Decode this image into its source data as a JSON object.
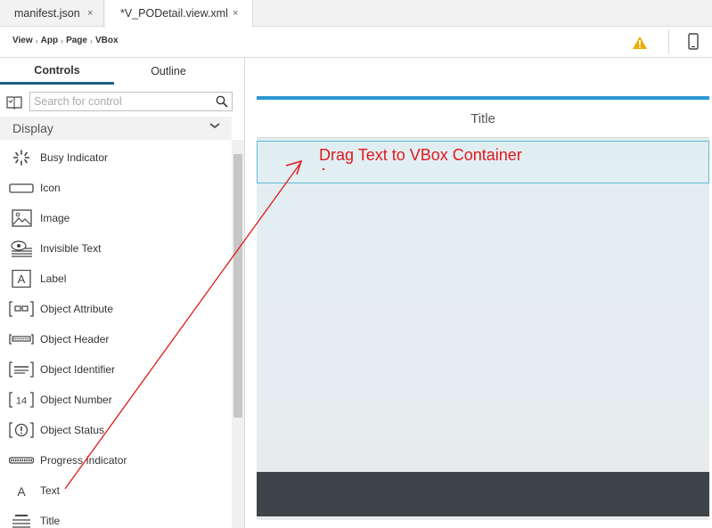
{
  "tabs": [
    {
      "label": "manifest.json",
      "close": "×"
    },
    {
      "label": "*V_PODetail.view.xml",
      "close": "×"
    }
  ],
  "breadcrumb": [
    "View",
    "App",
    "Page",
    "VBox"
  ],
  "panel_tabs": {
    "controls": "Controls",
    "outline": "Outline"
  },
  "search": {
    "placeholder": "Search for control",
    "value": ""
  },
  "category": {
    "label": "Display"
  },
  "controls": [
    {
      "label": "Busy Indicator",
      "icon": "busy-indicator-icon"
    },
    {
      "label": "Icon",
      "icon": "icon-placeholder-icon"
    },
    {
      "label": "Image",
      "icon": "image-icon"
    },
    {
      "label": "Invisible Text",
      "icon": "invisible-text-icon"
    },
    {
      "label": "Label",
      "icon": "label-icon"
    },
    {
      "label": "Object Attribute",
      "icon": "object-attribute-icon"
    },
    {
      "label": "Object Header",
      "icon": "object-header-icon"
    },
    {
      "label": "Object Identifier",
      "icon": "object-identifier-icon"
    },
    {
      "label": "Object Number",
      "icon": "object-number-icon"
    },
    {
      "label": "Object Status",
      "icon": "object-status-icon"
    },
    {
      "label": "Progress Indicator",
      "icon": "progress-indicator-icon"
    },
    {
      "label": "Text",
      "icon": "text-icon"
    },
    {
      "label": "Title",
      "icon": "title-icon"
    }
  ],
  "canvas": {
    "page_title": "Title"
  },
  "annotation": {
    "instruction": "Drag Text to VBox Container",
    "color": "#e0191c"
  },
  "colors": {
    "accent": "#2b97d6",
    "vbox_border": "#5fbad6",
    "footer": "#3f4448",
    "warning": "#f0ab00"
  }
}
